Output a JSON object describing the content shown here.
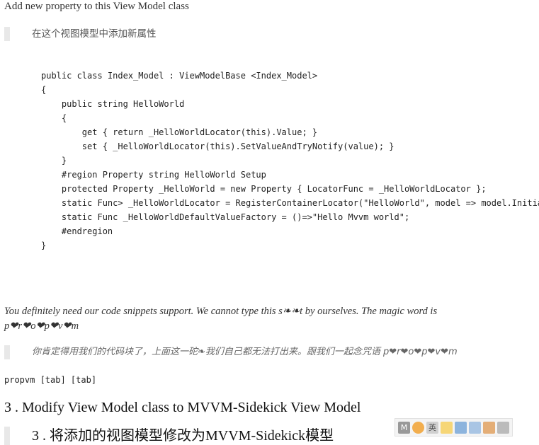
{
  "heading": "Add new property to this View Model class",
  "heading_cn": "在这个视图模型中添加新属性",
  "code_lines": [
    "public class Index_Model : ViewModelBase <Index_Model>",
    "{",
    "    public string HelloWorld",
    "    {",
    "        get { return _HelloWorldLocator(this).Value; }",
    "        set { _HelloWorldLocator(this).SetValueAndTryNotify(value); }",
    "    }",
    "    #region Property string HelloWorld Setup",
    "    protected Property _HelloWorld = new Property { LocatorFunc = _HelloWorldLocator };",
    "    static Func> _HelloWorldLocator = RegisterContainerLocator(\"HelloWorld\", model => model.Initiali",
    "    static Func _HelloWorldDefaultValueFactory = ()=>\"Hello Mvvm world\";",
    "    #endregion",
    "}"
  ],
  "note_line1": "You definitely need our code snippets support. We cannot type this s❧❧t by ourselves. The magic word is",
  "note_line2": "p❤r❤o❤p❤v❤m",
  "note_cn": "你肯定得用我们的代码块了，上面这一砣❧我们自己都无法打出来。跟我们一起念咒语 p❤r❤o❤p❤v❤m",
  "command": "propvm [tab] [tab]",
  "step3": "3 . Modify View Model class to MVVM-Sidekick View Model",
  "step3_cn": "3 . 将添加的视图模型修改为MVVM-Sidekick模型",
  "ime_toolbar": {
    "buttons": [
      "M",
      "",
      "英",
      "",
      "",
      "",
      "",
      ""
    ],
    "colors": [
      "#888888",
      "#f0a030",
      "#c8c8c8",
      "#f5d060",
      "#7aa7d8",
      "#9bbbe0",
      "#e0a060",
      "#b0b0b0"
    ],
    "icons": [
      "ime-mode-icon",
      "ime-logo-icon",
      "lang-switch-icon",
      "moon-icon",
      "punctuation-icon",
      "keyboard-icon",
      "skin-icon",
      "toolbox-icon"
    ]
  }
}
